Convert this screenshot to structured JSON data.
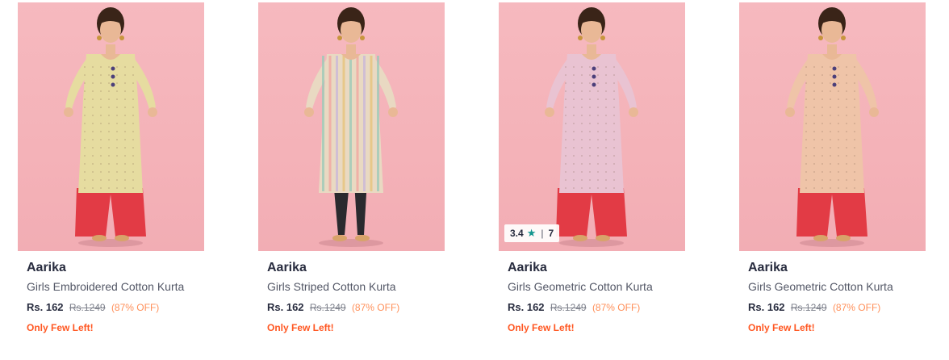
{
  "products": [
    {
      "brand": "Aarika",
      "name": "Girls Embroidered Cotton Kurta",
      "price": "Rs. 162",
      "mrp": "Rs.1249",
      "discount": "(87% OFF)",
      "stock_note": "Only Few Left!",
      "kurta_color": "#e6dca0",
      "pant_color": "#e23b45",
      "style": "embroidered"
    },
    {
      "brand": "Aarika",
      "name": "Girls Striped Cotton Kurta",
      "price": "Rs. 162",
      "mrp": "Rs.1249",
      "discount": "(87% OFF)",
      "stock_note": "Only Few Left!",
      "kurta_color": "#e9d9c2",
      "pant_color": "#2a2a2e",
      "style": "striped"
    },
    {
      "brand": "Aarika",
      "name": "Girls Geometric Cotton Kurta",
      "price": "Rs. 162",
      "mrp": "Rs.1249",
      "discount": "(87% OFF)",
      "stock_note": "Only Few Left!",
      "kurta_color": "#e9c3d2",
      "pant_color": "#e23b45",
      "style": "geometric",
      "rating": {
        "score": "3.4",
        "star_icon": "star-icon",
        "count": "7"
      }
    },
    {
      "brand": "Aarika",
      "name": "Girls Geometric Cotton Kurta",
      "price": "Rs. 162",
      "mrp": "Rs.1249",
      "discount": "(87% OFF)",
      "stock_note": "Only Few Left!",
      "kurta_color": "#efc4a8",
      "pant_color": "#e23b45",
      "style": "geometric"
    }
  ]
}
